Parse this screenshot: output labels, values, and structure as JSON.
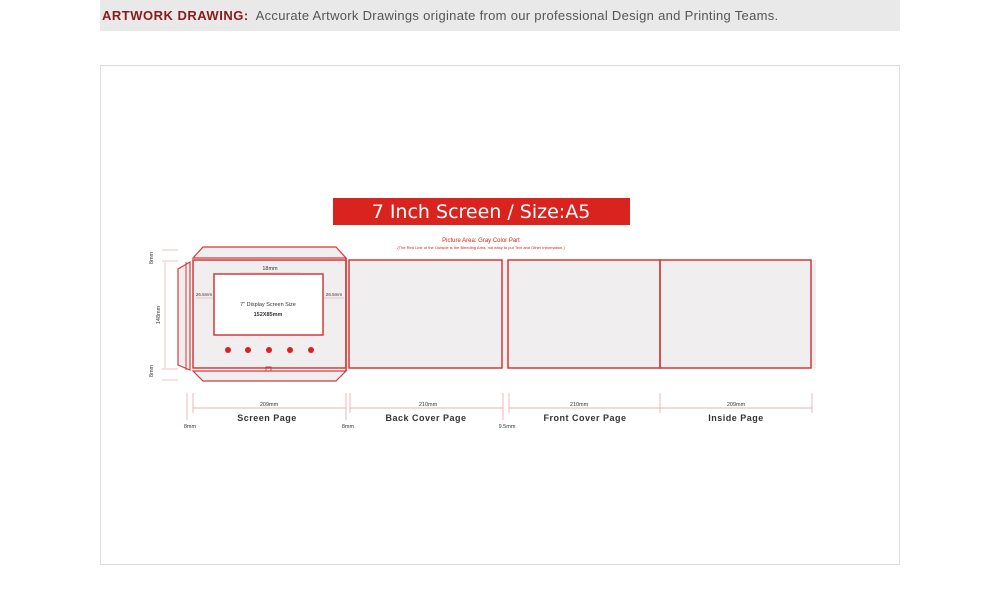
{
  "header": {
    "label": "ARTWORK DRAWING:",
    "text": "Accurate Artwork Drawings originate from our professional Design and Printing Teams."
  },
  "drawing": {
    "title": "7 Inch Screen  /  Size:A5",
    "picture_area_note": "Picture Area: Gray Color Part",
    "bleeding_note": "(The Red Line of the Outside is the Bleeding Area, not easy to put Text and Other Information.)",
    "screen_label": "7\" Display Screen Size",
    "screen_size": "152X85mm",
    "dims": {
      "top_margin": "18mm",
      "left_margin": "26.5mm",
      "right_margin": "26.5mm",
      "height_total": "148mm",
      "top_flap": "8mm",
      "bottom_flap": "8mm",
      "left_flap": "8mm",
      "screen_width": "209mm",
      "back_width": "210mm",
      "spine": "9.5mm",
      "front_width": "210mm",
      "inside_width": "209mm",
      "middle_flap": "8mm"
    },
    "panels": {
      "screen": "Screen Page",
      "back": "Back Cover Page",
      "front": "Front Cover Page",
      "inside": "Inside Page"
    },
    "colors": {
      "accent": "#d8231e",
      "line": "#d03c3c",
      "panel_fill": "#f1eeef",
      "dim_line": "#e49a9a"
    }
  }
}
